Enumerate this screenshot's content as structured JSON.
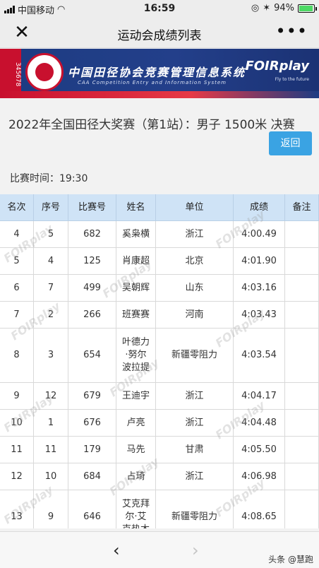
{
  "status_bar": {
    "carrier": "中国移动",
    "time": "16:59",
    "battery": "94%",
    "battery_level": 0.94
  },
  "navbar": {
    "title": "运动会成绩列表"
  },
  "banner": {
    "title_cn": "中国田径协会竞赛管理信息系统",
    "title_en": "CAA Competition Entry and Information System",
    "brand": "FOIRplay",
    "brand_sub": "Fly to the future",
    "lanes": "345678"
  },
  "heading": "2022年全国田径大奖赛（第1站）：男子 1500米 决赛",
  "back_button": "返回",
  "match_time": "比赛时间：19:30",
  "table": {
    "columns": [
      "名次",
      "序号",
      "比赛号",
      "姓名",
      "单位",
      "成绩",
      "备注"
    ],
    "rows": [
      {
        "rank": "4",
        "seq": "5",
        "bib": "682",
        "name": "奚枭横",
        "unit": "浙江",
        "result": "4:00.49",
        "note": ""
      },
      {
        "rank": "5",
        "seq": "4",
        "bib": "125",
        "name": "肖康超",
        "unit": "北京",
        "result": "4:01.90",
        "note": ""
      },
      {
        "rank": "6",
        "seq": "7",
        "bib": "499",
        "name": "吴朝辉",
        "unit": "山东",
        "result": "4:03.16",
        "note": ""
      },
      {
        "rank": "7",
        "seq": "2",
        "bib": "266",
        "name": "班赛赛",
        "unit": "河南",
        "result": "4:03.43",
        "note": ""
      },
      {
        "rank": "8",
        "seq": "3",
        "bib": "654",
        "name": "叶德力·努尔波拉提",
        "unit": "新疆零阻力",
        "result": "4:03.54",
        "note": ""
      },
      {
        "rank": "9",
        "seq": "12",
        "bib": "679",
        "name": "王迪宇",
        "unit": "浙江",
        "result": "4:04.17",
        "note": ""
      },
      {
        "rank": "10",
        "seq": "1",
        "bib": "676",
        "name": "卢亮",
        "unit": "浙江",
        "result": "4:04.48",
        "note": ""
      },
      {
        "rank": "11",
        "seq": "11",
        "bib": "179",
        "name": "马先",
        "unit": "甘肃",
        "result": "4:05.50",
        "note": ""
      },
      {
        "rank": "12",
        "seq": "10",
        "bib": "684",
        "name": "占琦",
        "unit": "浙江",
        "result": "4:06.98",
        "note": ""
      },
      {
        "rank": "13",
        "seq": "9",
        "bib": "646",
        "name": "艾克拜尔·艾克热木",
        "unit": "新疆零阻力",
        "result": "4:08.65",
        "note": ""
      }
    ]
  },
  "watermark_text": "FOIRplay",
  "bottom": {
    "prev": "‹",
    "next": "›",
    "credit": "头条 @慧跑"
  }
}
